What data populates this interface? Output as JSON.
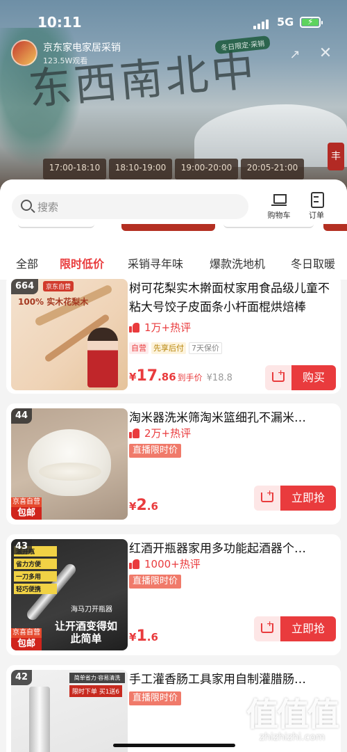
{
  "status_bar": {
    "time": "10:11",
    "network": "5G"
  },
  "live": {
    "streamer_name": "京东家电家居采销",
    "viewers": "123.5W观看",
    "title_art": "东西南北中",
    "title_badge": "冬日限定·采销",
    "time_slots": [
      "17:00-18:10",
      "18:10-19:00",
      "19:00-20:00",
      "20:05-21:00"
    ],
    "side_badge": "丰"
  },
  "search": {
    "placeholder": "搜索"
  },
  "header_actions": {
    "cart_label": "购物车",
    "order_label": "订单"
  },
  "tabs": [
    "全部",
    "限时低价",
    "采销寻年味",
    "爆款洗地机",
    "冬日取暖"
  ],
  "active_tab_index": 1,
  "products": [
    {
      "rank": "664",
      "title": "树可花梨实木擀面杖家用食品级儿童不粘大号饺子皮面条小杆面棍烘焙棒",
      "reviews": "1万+热评",
      "tags": [
        "自营",
        "先享后付",
        "7天保价"
      ],
      "price_yen": "¥",
      "price_int": "17",
      "price_dec": ".86",
      "price_after": "到手价",
      "price_orig": "¥18.8",
      "button": "购买",
      "thumb_text": "100% 实木花梨木",
      "thumb_badge": "京东自营"
    },
    {
      "rank": "44",
      "title": "淘米器洗米筛淘米篮细孔不漏米…",
      "reviews": "2万+热评",
      "live_tag": "直播限时价",
      "price_yen": "¥",
      "price_int": "2",
      "price_dec": ".6",
      "button": "立即抢",
      "promo_top": "京喜自营",
      "promo_bottom": "包邮"
    },
    {
      "rank": "43",
      "title": "红酒开瓶器家用多功能起酒器个…",
      "reviews": "1000+热评",
      "live_tag": "直播限时价",
      "price_yen": "¥",
      "price_int": "1",
      "price_dec": ".6",
      "button": "立即抢",
      "promo_top": "京喜自营",
      "promo_bottom": "包邮",
      "thumb_labels": [
        "滚开瓶",
        "省力方便",
        "一刀多用",
        "轻巧便携"
      ],
      "thumb_caption": "让开酒变得如此简单",
      "thumb_caption2": "海马刀开瓶器"
    },
    {
      "rank": "42",
      "title": "手工灌香肠工具家用自制灌腊肠…",
      "live_tag": "直播限时价",
      "thumb_top": "简单省力·容易清洗",
      "thumb_banner": "限时下单 买1送6"
    }
  ],
  "watermark": {
    "mark": "值值值",
    "url": "zhizhizhi.com"
  },
  "colors": {
    "accent": "#e93b3d",
    "live_tag": "#f07a6a"
  }
}
